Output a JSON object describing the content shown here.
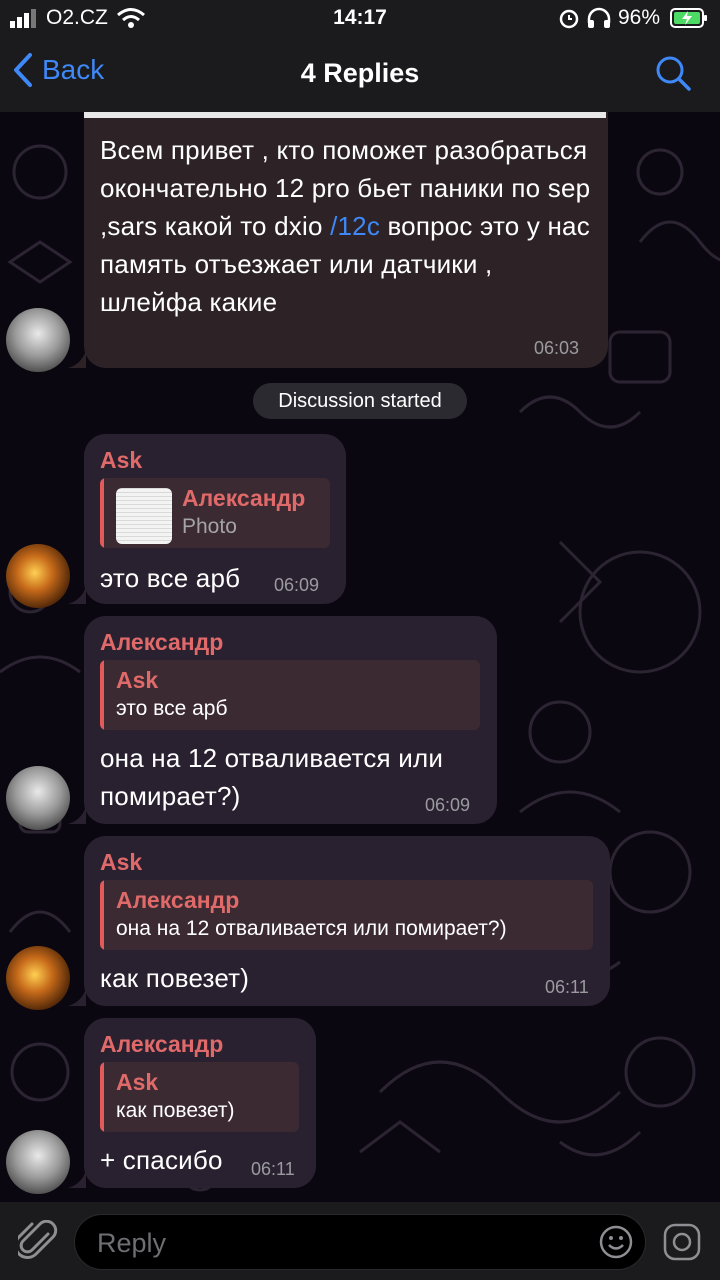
{
  "status_bar": {
    "carrier": "O2.CZ",
    "time": "14:17",
    "battery_percent": "96%"
  },
  "nav": {
    "back_label": "Back",
    "title": "4 Replies"
  },
  "post": {
    "text_before_link": "Всем привет , кто поможет разобраться окончательно 12 pro бьет паники по sep ,sars какой то dxio ",
    "link": "/12c",
    "text_after_link": "  вопрос это у нас память отъезжает или датчики , шлейфа какие",
    "time": "06:03"
  },
  "service_message": "Discussion started",
  "messages": [
    {
      "sender": "Ask",
      "reply_to": {
        "name": "Александр",
        "text": "Photo"
      },
      "text": "это все арб",
      "time": "06:09"
    },
    {
      "sender": "Александр",
      "reply_to": {
        "name": "Ask",
        "text": "это все арб"
      },
      "text": "она на 12 отваливается или помирает?)",
      "time": "06:09"
    },
    {
      "sender": "Ask",
      "reply_to": {
        "name": "Александр",
        "text": "она на 12 отваливается или помирает?)"
      },
      "text": "как повезет)",
      "time": "06:11"
    },
    {
      "sender": "Александр",
      "reply_to": {
        "name": "Ask",
        "text": "как повезет)"
      },
      "text": "+ спасибо",
      "time": "06:11"
    }
  ],
  "input": {
    "placeholder": "Reply"
  },
  "colors": {
    "accent": "#3e88f7",
    "sender_name": "#e06a6a",
    "bubble": "#2a2130"
  }
}
